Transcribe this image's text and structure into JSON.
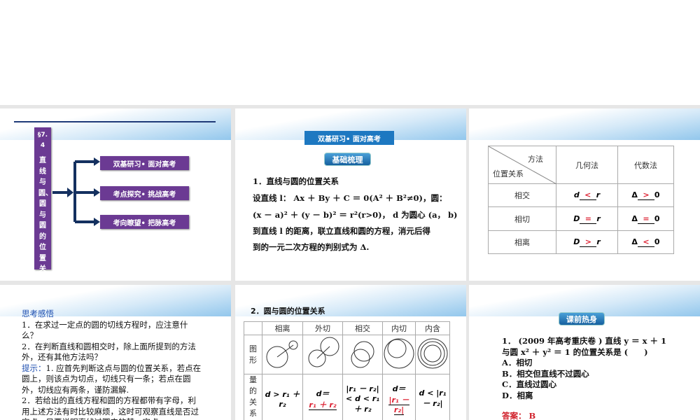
{
  "slide1": {
    "section": "§7.4",
    "vertical_title": "直线与圆、圆与圆的位置关",
    "items": [
      "双基研习• 面对高考",
      "考点探究• 挑战高考",
      "考向瞭望• 把脉高考"
    ]
  },
  "slide2": {
    "banner": "双基研习• 面对高考",
    "badge": "基础梳理",
    "lines": [
      "1．直线与圆的位置关系",
      "设直线 l： Ax ＋ By ＋ C ＝ 0(A² ＋ B²≠0)，圆：",
      "(x － a)² ＋ (y － b)² ＝ r²(r>0)， d 为圆心 (a， b)",
      "到直线 l 的距离，联立直线和圆的方程，消元后得",
      "到的一元二次方程的判别式为 Δ."
    ]
  },
  "slide3": {
    "corner_top": "方法",
    "corner_bottom": "位置关系",
    "headers": [
      "几何法",
      "代数法"
    ],
    "rows": [
      {
        "label": "相交",
        "geo_left": "d",
        "geo_sign": "<",
        "geo_right": "r",
        "alg_left": "Δ",
        "alg_sign": ">",
        "alg_right": "0"
      },
      {
        "label": "相切",
        "geo_left": "D",
        "geo_sign": "=",
        "geo_right": "r",
        "alg_left": "Δ",
        "alg_sign": "=",
        "alg_right": "0"
      },
      {
        "label": "相离",
        "geo_left": "D",
        "geo_sign": ">",
        "geo_right": "r",
        "alg_left": "Δ",
        "alg_sign": "<",
        "alg_right": "0"
      }
    ]
  },
  "slide4": {
    "heading": "思考感悟",
    "q1": "1．在求过一定点的圆的切线方程时，应注意什么？",
    "q2": "2．在判断直线和圆相交时，除上面所提到的方法外，还有其他方法吗？",
    "hint_label": "提示：",
    "hint1": "1. 应首先判断这点与圆的位置关系，若点在圆上，则该点为切点，切线只有一条；若点在圆外，切线应有两条，谨防漏解.",
    "hint2": "2．若给出的直线方程和圆的方程都带有字母，利用上述方法有时比较麻烦，这时可观察直线是否过定点，只要说明直线过圆内的某一定点"
  },
  "slide5": {
    "title": "2．圆与圆的位置关系",
    "headers": [
      "相离",
      "外切",
      "相交",
      "内切",
      "内含"
    ],
    "row_fig": "图形",
    "row_qty": "量的关系",
    "qty": [
      "d > r₁ ＋ r₂",
      "d＝",
      "|r₁ － r₂| < d < r₁ ＋ r₂",
      "d＝",
      "d < |r₁ － r₂|"
    ],
    "qty_red": [
      "r₁ ＋ r₂",
      "|r₁ － r₂|"
    ]
  },
  "slide6": {
    "badge": "课前热身",
    "question": "1． (2009 年高考重庆卷 ) 直线 y ＝ x ＋ 1 与圆 x² ＋ y² ＝ 1 的位置关系是 (　　)",
    "options": [
      "A．相切",
      "B．相交但直线不过圆心",
      "C．直线过圆心",
      "D．相离"
    ],
    "answer_label": "答案：",
    "answer": "B"
  }
}
